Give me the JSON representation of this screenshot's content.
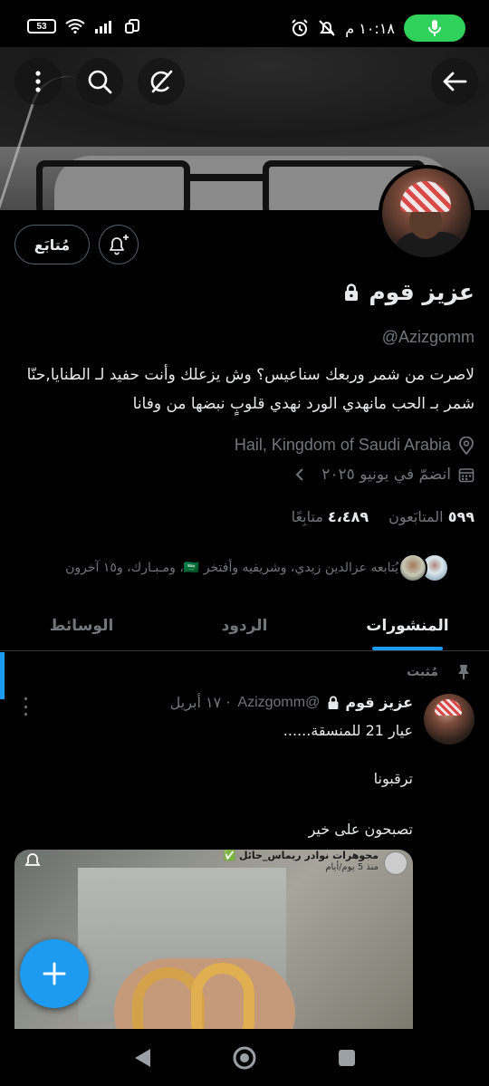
{
  "status_bar": {
    "battery": "53",
    "time": "١٠:١٨ م"
  },
  "header": {
    "back_icon": "arrow-left-icon",
    "icons": [
      "more-vertical-icon",
      "search-icon",
      "grok-icon"
    ]
  },
  "profile": {
    "follow_label": "مُتابَع",
    "name": "عزيز قوم",
    "handle": "@Azizgomm",
    "bio_line1": "لاصرت من شمر وربعك سناعيس؟ وش يزعلك وأنت حفيد لـ الطنايا,حنّا",
    "bio_line2": "شمر بـ الحب مانهدي الورد نهدي قلوبٍ نبضها من وفانا",
    "location": "Hail, Kingdom of Saudi Arabia",
    "joined": "انضمّ في يونيو ٢٠٢٥",
    "followers_count": "٥٩٩",
    "followers_label": "المتابَعون",
    "following_count": "٤،٤٨٩",
    "following_label": "متابِعًا",
    "followed_by": "يُتابعه عزالدين زيدي، وشريفيه وأفتخر 🇸🇦، ومـبـارك، و١٥ آخرون"
  },
  "tabs": [
    {
      "label": "المنشورات",
      "active": true
    },
    {
      "label": "الردود",
      "active": false
    },
    {
      "label": "الوسائط",
      "active": false
    }
  ],
  "post": {
    "pinned_label": "مُثبت",
    "name": "عزيز قوم",
    "handle": "@Azizgomm",
    "date": "· ١٧ أبريل",
    "line1": "عيار 21 للمنسقة......",
    "line2": "ترقبونا",
    "line3": "تصبحون على خير",
    "media_caption1": "مجوهرات نوادر ريماس_حائل ✅",
    "media_caption2": "منذ 5 يوم/أيام"
  },
  "colors": {
    "accent": "#1d9bf0",
    "secondary_text": "#71767b",
    "border": "#2f3336",
    "mic_pill": "#2fd15a"
  }
}
